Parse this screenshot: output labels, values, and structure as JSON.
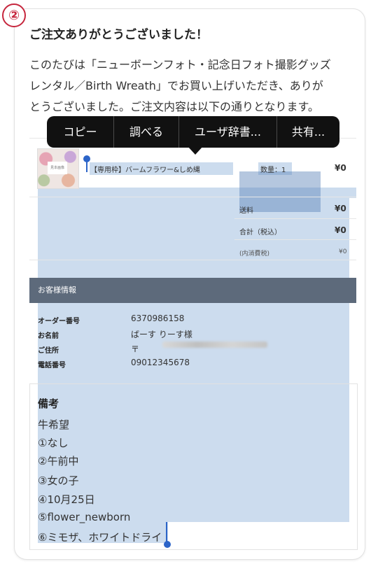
{
  "badge": "②",
  "title": "ご注文ありがとうございました！",
  "message_lines": [
    "このたびは「ニューボーンフォト・記念日フォト撮影グッズ",
    "レンタル／Birth Wreath」でお買い上げいただき、ありが",
    "とうございました。ご注文内容は以下の通りとなります。"
  ],
  "context_menu": {
    "items": [
      "コピー",
      "調べる",
      "ユーザ辞書...",
      "共有..."
    ]
  },
  "order_item": {
    "thumb_label": "見本画像",
    "name": "【専用枠】バームフラワー&しめ縄",
    "quantity": "数量：1",
    "price": "¥0"
  },
  "totals": {
    "shipping_label": "送料",
    "shipping_value": "¥0",
    "total_label": "合計（税込）",
    "total_value": "¥0",
    "tax_label": "(内消費税)",
    "tax_value": "¥0"
  },
  "customer_section": {
    "header": "お客様情報",
    "rows": [
      {
        "label": "オーダー番号",
        "value": "6370986158"
      },
      {
        "label": "お名前",
        "value": "ばーす りーす様"
      },
      {
        "label": "ご住所",
        "value": "〒"
      },
      {
        "label": "電話番号",
        "value": "09012345678"
      }
    ]
  },
  "remarks": {
    "title": "備考",
    "lines": [
      "牛希望",
      "①なし",
      "②午前中",
      "③女の子",
      "④10月25日",
      "⑤flower_newborn",
      "⑥ミモザ、ホワイトドライ"
    ]
  }
}
